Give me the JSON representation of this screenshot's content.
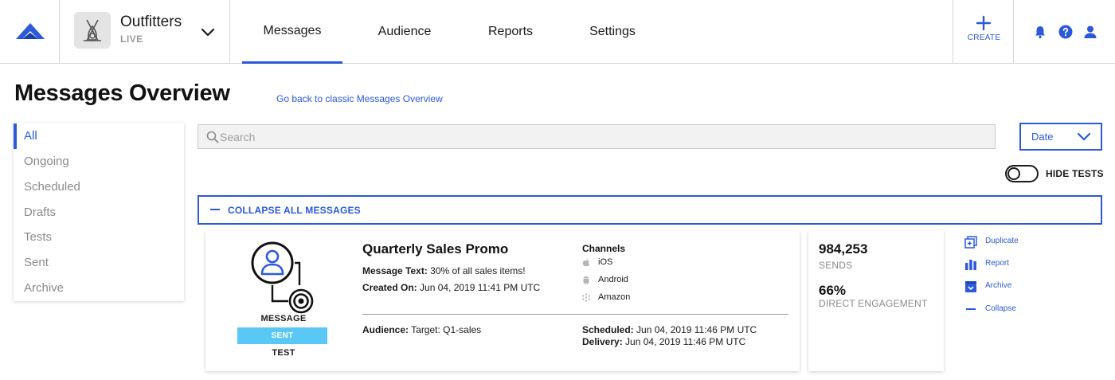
{
  "header": {
    "app_name": "Outfitters",
    "app_env": "LIVE",
    "tabs": [
      {
        "label": "Messages",
        "active": true
      },
      {
        "label": "Audience",
        "active": false
      },
      {
        "label": "Reports",
        "active": false
      },
      {
        "label": "Settings",
        "active": false
      }
    ],
    "create_label": "CREATE",
    "icons": [
      "bell-icon",
      "help-icon",
      "user-icon"
    ]
  },
  "page": {
    "title": "Messages Overview",
    "classic_link": "Go back to classic Messages Overview"
  },
  "filters": {
    "items": [
      {
        "label": "All",
        "active": true
      },
      {
        "label": "Ongoing",
        "active": false
      },
      {
        "label": "Scheduled",
        "active": false
      },
      {
        "label": "Drafts",
        "active": false
      },
      {
        "label": "Tests",
        "active": false
      },
      {
        "label": "Sent",
        "active": false
      },
      {
        "label": "Archive",
        "active": false
      }
    ]
  },
  "search": {
    "placeholder": "Search",
    "value": ""
  },
  "sort": {
    "selected": "Date"
  },
  "hide_tests": {
    "label": "HIDE TESTS",
    "on": false
  },
  "collapse_all": {
    "label": "COLLAPSE ALL MESSAGES"
  },
  "message": {
    "type": "MESSAGE",
    "status": "SENT",
    "test_label": "TEST",
    "title": "Quarterly Sales Promo",
    "text_label": "Message Text:",
    "text_value": "30% of all sales items!",
    "created_label": "Created On:",
    "created_value": "Jun 04, 2019 11:41 PM UTC",
    "channels_title": "Channels",
    "channels": [
      "iOS",
      "Android",
      "Amazon"
    ],
    "audience_label": "Audience:",
    "audience_value": "Target: Q1-sales",
    "scheduled_label": "Scheduled:",
    "scheduled_value": "Jun 04, 2019 11:46 PM UTC",
    "delivery_label": "Delivery:",
    "delivery_value": "Jun 04, 2019 11:46 PM UTC"
  },
  "stats": {
    "sends_value": "984,253",
    "sends_label": "SENDS",
    "engagement_value": "66%",
    "engagement_label": "DIRECT ENGAGEMENT"
  },
  "actions": [
    {
      "label": "Duplicate",
      "icon": "duplicate-icon"
    },
    {
      "label": "Report",
      "icon": "report-icon"
    },
    {
      "label": "Archive",
      "icon": "archive-icon"
    },
    {
      "label": "Collapse",
      "icon": "collapse-icon"
    }
  ],
  "colors": {
    "accent": "#2b59d9",
    "status_sent": "#5ac8f5",
    "muted_text": "#8a8a8a",
    "border": "#d6d6d6"
  }
}
